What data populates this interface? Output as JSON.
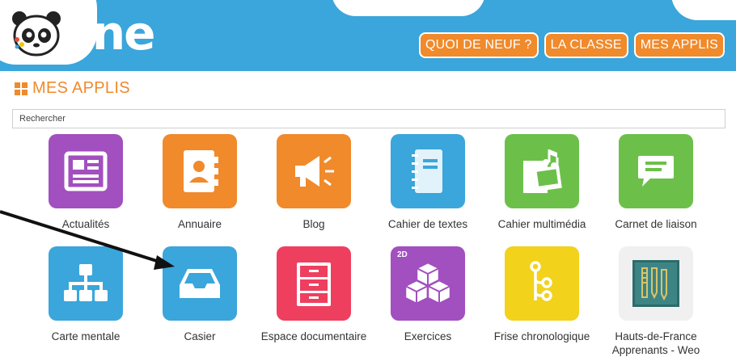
{
  "header": {
    "logo_text": "one",
    "nav": [
      "QUOI DE NEUF ?",
      "LA CLASSE",
      "MES APPLIS"
    ]
  },
  "section": {
    "title": "MES APPLIS"
  },
  "search": {
    "placeholder": "Rechercher"
  },
  "apps": [
    {
      "label": "Actualités",
      "color": "#a24fbf",
      "icon": "newspaper-icon"
    },
    {
      "label": "Annuaire",
      "color": "#f08a2b",
      "icon": "contact-book-icon"
    },
    {
      "label": "Blog",
      "color": "#f08a2b",
      "icon": "megaphone-icon"
    },
    {
      "label": "Cahier de textes",
      "color": "#3aa6db",
      "icon": "notebook-icon"
    },
    {
      "label": "Cahier multimédia",
      "color": "#6cc04a",
      "icon": "multimedia-notebook-icon"
    },
    {
      "label": "Carnet de liaison",
      "color": "#6cc04a",
      "icon": "speech-bubble-icon"
    },
    {
      "label": "Carte mentale",
      "color": "#3aa6db",
      "icon": "org-chart-icon"
    },
    {
      "label": "Casier",
      "color": "#3aa6db",
      "icon": "inbox-tray-icon"
    },
    {
      "label": "Espace documentaire",
      "color": "#ee3f5f",
      "icon": "filing-cabinet-icon"
    },
    {
      "label": "Exercices",
      "color": "#a24fbf",
      "icon": "cubes-icon",
      "badge": "2D"
    },
    {
      "label": "Frise chronologique",
      "color": "#f2d21b",
      "icon": "timeline-icon"
    },
    {
      "label": "Hauts-de-France Apprenants - Weo",
      "color": "#f0f0f0",
      "icon": "weo-logo-icon"
    }
  ]
}
